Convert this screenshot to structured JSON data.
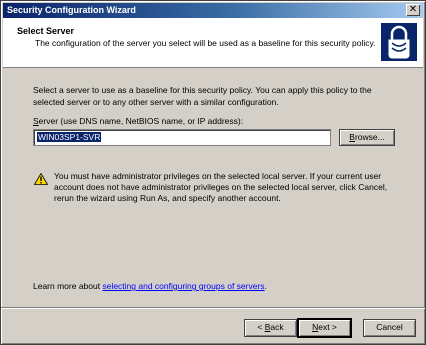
{
  "window": {
    "title": "Security Configuration Wizard",
    "close_glyph": "✕"
  },
  "header": {
    "title": "Select Server",
    "description": "The configuration of the server you select will be used as a baseline for this security policy.",
    "icon": "padlock-icon"
  },
  "main": {
    "intro": "Select a server to use as a baseline for this security policy. You can apply this policy to the selected server or to any other server with a similar configuration.",
    "server_label": "Server (use DNS name, NetBIOS name, or IP address):",
    "server_value": "WIN03SP1-SVR",
    "browse_label": "Browse...",
    "warning_text": "You must have administrator privileges on the selected local server. If your current user account does not have administrator privileges on the selected local server, click Cancel, rerun the wizard using Run As, and specify another account.",
    "warning_icon": "warning-icon",
    "learn_prefix": "Learn more about ",
    "learn_link": "selecting and configuring groups of servers",
    "learn_suffix": "."
  },
  "footer": {
    "back_label": "< Back",
    "next_label": "Next >",
    "cancel_label": "Cancel"
  },
  "colors": {
    "titlebar": "#0a246a",
    "face": "#d4d0c8",
    "link": "#0000ff"
  }
}
